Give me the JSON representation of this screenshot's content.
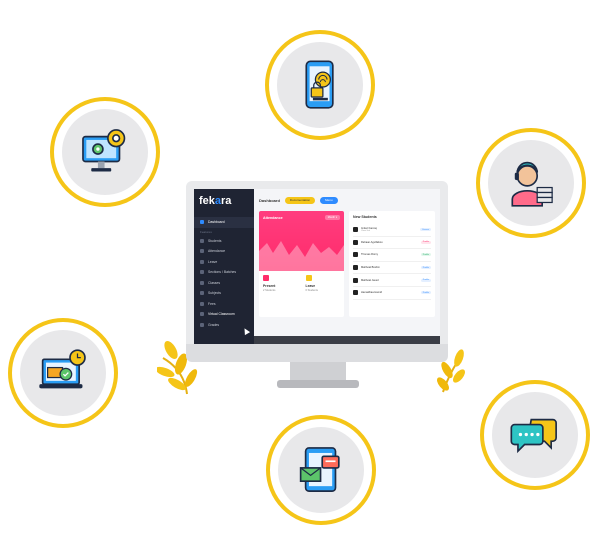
{
  "features": [
    {
      "id": "settings",
      "icon": "monitor-settings-icon"
    },
    {
      "id": "phone",
      "icon": "phone-security-icon"
    },
    {
      "id": "support",
      "icon": "support-agent-icon"
    },
    {
      "id": "schedule",
      "icon": "laptop-schedule-icon"
    },
    {
      "id": "messages",
      "icon": "tablet-messages-icon"
    },
    {
      "id": "chat",
      "icon": "chat-bubbles-icon"
    }
  ],
  "colors": {
    "ring": "#f5c518",
    "accent": "#2e8bff",
    "attendance": "#ff2b6a",
    "sidebar": "#1f2433"
  },
  "app": {
    "logo_prefix": "fek",
    "logo_accent": "a",
    "logo_suffix": "ra"
  },
  "sidebar": {
    "active": "Dashboard",
    "section": "Features",
    "items": [
      "Students",
      "Attendance",
      "Leave",
      "Sections / Batches",
      "Classes",
      "Subjects",
      "Fees",
      "Virtual Classroom",
      "Grades"
    ]
  },
  "topbar": {
    "title": "Dashboard",
    "pill_yellow": "Documentation",
    "pill_blue": "Menu"
  },
  "attendance": {
    "title": "Attendance",
    "month": "Month ▾",
    "present_label": "Present",
    "present_value": "2 Students",
    "leave_label": "Leave",
    "leave_value": "0 Students"
  },
  "new_students": {
    "title": "New Students",
    "rows": [
      {
        "name": "Imtiaz Farooq",
        "sub": "Class 2nd",
        "tag": "Course",
        "tag_color": "blue"
      },
      {
        "name": "Rehaan Agvillaboo",
        "sub": "",
        "tag": "Profile",
        "tag_color": "pink"
      },
      {
        "name": "Thomas Rorny",
        "sub": "",
        "tag": "Profile",
        "tag_color": "green"
      },
      {
        "name": "Mahboal Brahim",
        "sub": "",
        "tag": "Profile",
        "tag_color": "blue"
      },
      {
        "name": "Mahboal Javed",
        "sub": "",
        "tag": "Profile",
        "tag_color": "blue"
      },
      {
        "name": "Hamadhaa Hamid",
        "sub": "",
        "tag": "Profile",
        "tag_color": "blue"
      }
    ]
  }
}
